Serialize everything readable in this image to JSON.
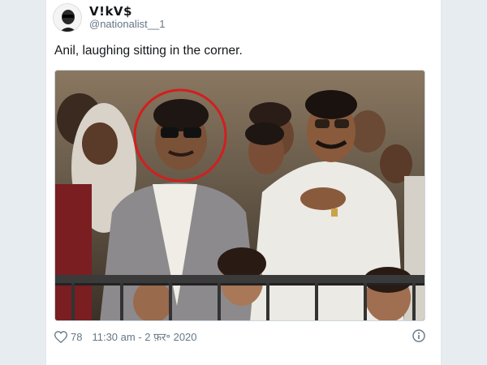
{
  "tweet": {
    "display_name": "V!kV$",
    "handle": "@nationalist__1",
    "text": "Anil, laughing sitting in the corner.",
    "likes": "78",
    "timestamp": "11:30 am - 2 फ़र॰ 2020"
  },
  "icons": {
    "like": "heart-icon",
    "info": "info-icon"
  },
  "colors": {
    "highlight_circle": "#d11f1f",
    "text": "#14171a",
    "muted": "#657786"
  }
}
